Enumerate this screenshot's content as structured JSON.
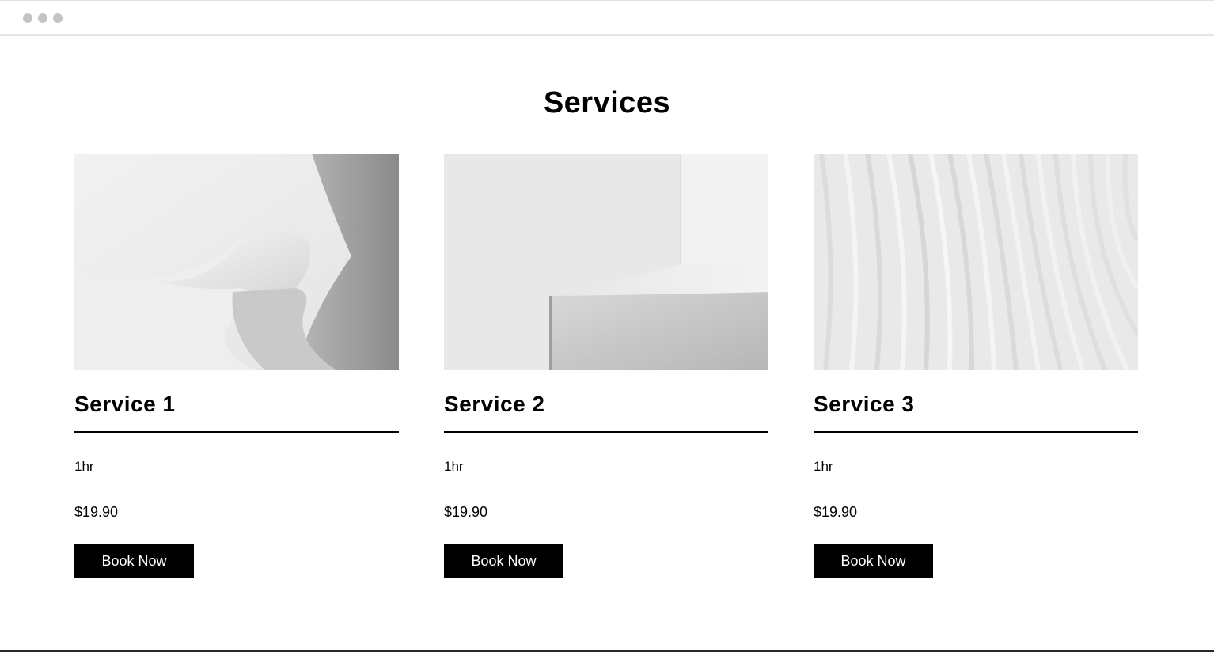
{
  "page": {
    "title": "Services"
  },
  "services": [
    {
      "title": "Service 1",
      "duration": "1hr",
      "price": "$19.90",
      "button_label": "Book Now",
      "image": "abstract-paper-fold"
    },
    {
      "title": "Service 2",
      "duration": "1hr",
      "price": "$19.90",
      "button_label": "Book Now",
      "image": "abstract-corner-step"
    },
    {
      "title": "Service 3",
      "duration": "1hr",
      "price": "$19.90",
      "button_label": "Book Now",
      "image": "abstract-curved-lines"
    }
  ],
  "colors": {
    "background": "#ffffff",
    "text": "#000000",
    "button_bg": "#000000",
    "button_text": "#ffffff",
    "browser_dots": "#c4c4c8"
  }
}
